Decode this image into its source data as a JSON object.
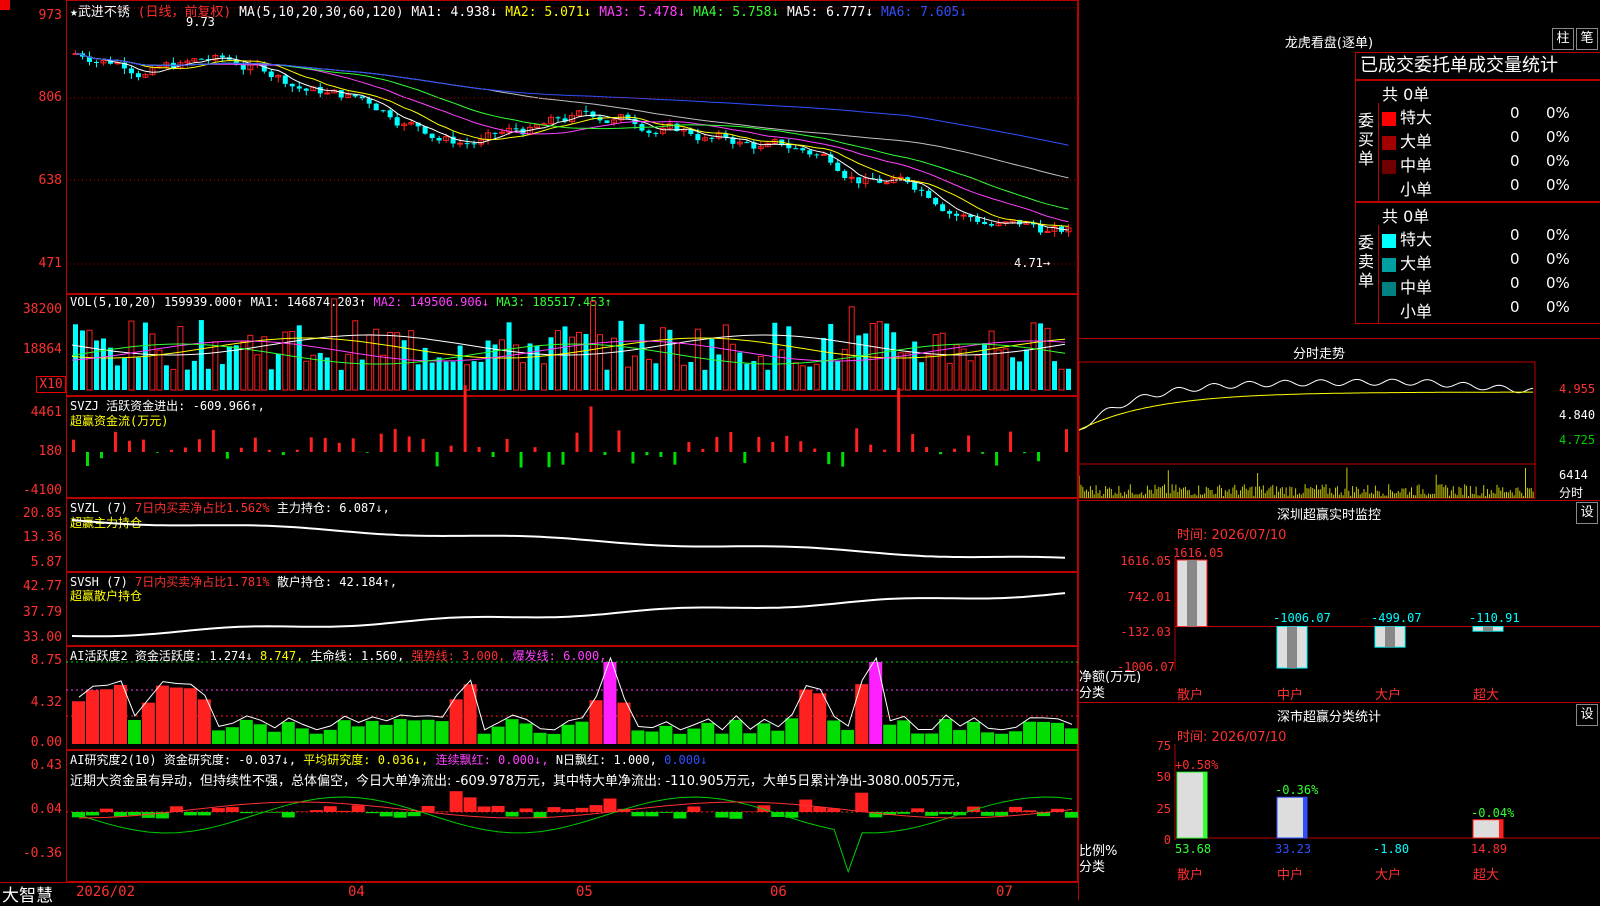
{
  "stock": {
    "name": "武进不锈",
    "period": "(日线，前复权)",
    "ma_label": "MA(5,10,20,30,60,120)",
    "ma1": "MA1: 4.938↓",
    "ma2": "MA2: 5.071↓",
    "ma3": "MA3: 5.478↓",
    "ma4": "MA4: 5.758↓",
    "ma5": "MA5: 6.777↓",
    "ma6": "MA6: 7.605↓",
    "high_mark": "9.73",
    "low_mark": "4.71→",
    "price_axis": [
      "973",
      "806",
      "638",
      "471"
    ]
  },
  "vol": {
    "label": "VOL(5,10,20)",
    "value": "159939.000↑",
    "ma1": "MA1: 146874.203↑",
    "ma2": "MA2: 149506.906↓",
    "ma3": "MA3: 185517.453↑",
    "axis": [
      "38200",
      "18864",
      "X10"
    ]
  },
  "svzj": {
    "label": "SVZJ",
    "text1": "活跃资金进出: -609.966↑,",
    "text2": "超赢资金流(万元)",
    "axis": [
      "4461",
      "180",
      "-4100"
    ]
  },
  "svzl": {
    "label": "SVZL (7)",
    "text1": "7日内买卖净占比1.562%",
    "text2": "主力持仓: 6.087↓,",
    "text3": "超赢主力持仓",
    "axis": [
      "20.85",
      "13.36",
      "5.87"
    ]
  },
  "svsh": {
    "label": "SVSH (7)",
    "text1": "7日内买卖净占比1.781%",
    "text2": "散户持仓: 42.184↑,",
    "text3": "超赢散户持仓",
    "axis": [
      "42.77",
      "37.79",
      "33.00"
    ]
  },
  "ai1": {
    "label": "AI活跃度2",
    "t1": "资金活跃度: 1.274↓",
    "t2": "8.747,",
    "t3": "生命线: 1.560,",
    "t4": "强势线: 3.000,",
    "t5": "爆发线: 6.000,",
    "axis": [
      "8.75",
      "4.32",
      "0.00"
    ]
  },
  "ai2": {
    "label": "AI研究度2(10)",
    "t1": "资金研究度: -0.037↓,",
    "t2": "平均研究度: 0.036↓,",
    "t3": "连续飘红: 0.000↓,",
    "t4": "N日飘红: 1.000,",
    "t5": "0.000↓",
    "note": "近期大资金虽有异动，但持续性不强，总体偏空，今日大单净流出: -609.978万元，其中特大单净流出: -110.905万元，大单5日累计净出-3080.005万元，",
    "axis": [
      "0.43",
      "0.04",
      "-0.36"
    ]
  },
  "dates": {
    "brand": "大智慧",
    "labels": [
      "2026/02",
      "04",
      "05",
      "06",
      "07"
    ]
  },
  "right": {
    "lhb_title": "龙虎看盘(逐单)",
    "btn1": "柱",
    "btn2": "笔",
    "tab_title": "已成交委托单成交量统计",
    "buy_total": "共 0单",
    "buy_side": "委买单",
    "sell_total": "共 0单",
    "sell_side": "委卖单",
    "buy_rows": [
      {
        "label": "特大",
        "val": "0",
        "pct": "0%",
        "color": "#ff0000"
      },
      {
        "label": "大单",
        "val": "0",
        "pct": "0%",
        "color": "#a00000"
      },
      {
        "label": "中单",
        "val": "0",
        "pct": "0%",
        "color": "#700000"
      },
      {
        "label": "小单",
        "val": "0",
        "pct": "0%",
        "color": ""
      }
    ],
    "sell_rows": [
      {
        "label": "特大",
        "val": "0",
        "pct": "0%",
        "color": "#00ffff"
      },
      {
        "label": "大单",
        "val": "0",
        "pct": "0%",
        "color": "#00a0a0"
      },
      {
        "label": "中单",
        "val": "0",
        "pct": "0%",
        "color": "#008080"
      },
      {
        "label": "小单",
        "val": "0",
        "pct": "0%",
        "color": ""
      }
    ],
    "fs_title": "分时走势",
    "fs_axis": [
      "4.955",
      "4.840",
      "4.725",
      "6414",
      "分时"
    ],
    "mon_title": "深圳超赢实时监控",
    "mon_btn": "设",
    "mon_time": "时间: 2026/07/10",
    "mon_axis": [
      "1616.05",
      "742.01",
      "-132.03",
      "-1006.07"
    ],
    "mon_vals": [
      "1616.05",
      "-1006.07",
      "-499.07",
      "-110.91"
    ],
    "mon_unit": "净额(万元)",
    "mon_class": "分类",
    "cats": [
      "散户",
      "中户",
      "大户",
      "超大"
    ],
    "cls_title": "深市超赢分类统计",
    "cls_btn": "设",
    "cls_time": "时间: 2026/07/10",
    "cls_axis": [
      "75",
      "50",
      "25",
      "0"
    ],
    "cls_top": [
      "+0.58%",
      "-0.36%",
      "-0.04%"
    ],
    "cls_bottom": [
      "53.68",
      "33.23",
      "-1.80",
      "14.89"
    ],
    "cls_unit": "比例%",
    "cls_class": "分类"
  },
  "chart_data": {
    "type": "bar",
    "title": "深圳超赢实时监控",
    "categories": [
      "散户",
      "中户",
      "大户",
      "超大"
    ],
    "values": [
      1616.05,
      -1006.07,
      -499.07,
      -110.91
    ],
    "ylabel": "净额(万元)",
    "ylim": [
      -1006.07,
      1616.05
    ]
  }
}
